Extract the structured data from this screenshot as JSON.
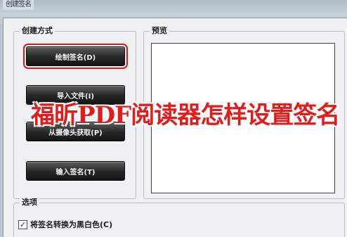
{
  "window": {
    "title": "创建签名"
  },
  "create_group": {
    "label": "创建方式",
    "buttons": {
      "draw": "绘制签名(D)",
      "import": "导入文件(I)",
      "camera": "从摄像头获取(P)",
      "type": "输入签名(T)"
    }
  },
  "preview_group": {
    "label": "预览"
  },
  "options_group": {
    "label": "选项",
    "convert_checkbox": {
      "label": "将签名转换为黑白色(C)",
      "checked": true,
      "mark": "✓"
    }
  },
  "overlay_caption": "福昕PDF阅读器怎样设置签名",
  "colors": {
    "focus_outline": "#d41b1b",
    "caption": "#e21b1b"
  }
}
